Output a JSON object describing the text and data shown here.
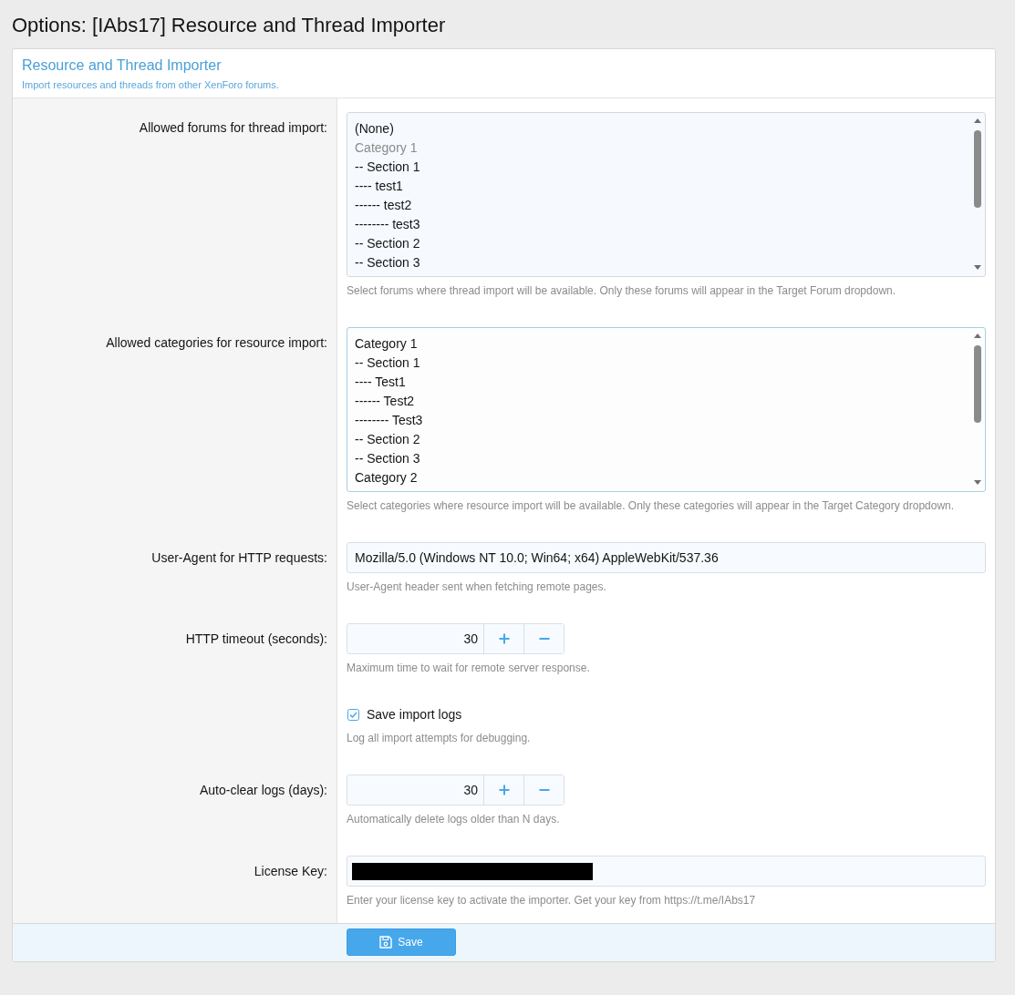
{
  "page_title": "Options: [IAbs17] Resource and Thread Importer",
  "block": {
    "title": "Resource and Thread Importer",
    "description": "Import resources and threads from other XenForo forums."
  },
  "options": [
    {
      "kind": "listbox",
      "label": "Allowed forums for thread import:",
      "focused": false,
      "items": [
        {
          "text": "(None)",
          "disabled": false
        },
        {
          "text": "Category 1",
          "disabled": true
        },
        {
          "text": "-- Section 1",
          "disabled": false
        },
        {
          "text": "---- test1",
          "disabled": false
        },
        {
          "text": "------ test2",
          "disabled": false
        },
        {
          "text": "-------- test3",
          "disabled": false
        },
        {
          "text": "-- Section 2",
          "disabled": false
        },
        {
          "text": "-- Section 3",
          "disabled": false
        }
      ],
      "hint": "Select forums where thread import will be available. Only these forums will appear in the Target Forum dropdown."
    },
    {
      "kind": "listbox",
      "label": "Allowed categories for resource import:",
      "focused": true,
      "items": [
        {
          "text": "Category 1",
          "disabled": false
        },
        {
          "text": "-- Section 1",
          "disabled": false
        },
        {
          "text": "---- Test1",
          "disabled": false
        },
        {
          "text": "------ Test2",
          "disabled": false
        },
        {
          "text": "-------- Test3",
          "disabled": false
        },
        {
          "text": "-- Section 2",
          "disabled": false
        },
        {
          "text": "-- Section 3",
          "disabled": false
        },
        {
          "text": "Category 2",
          "disabled": false
        }
      ],
      "hint": "Select categories where resource import will be available. Only these categories will appear in the Target Category dropdown."
    },
    {
      "kind": "text",
      "label": "User-Agent for HTTP requests:",
      "value": "Mozilla/5.0 (Windows NT 10.0; Win64; x64) AppleWebKit/537.36",
      "hint": "User-Agent header sent when fetching remote pages."
    },
    {
      "kind": "number",
      "label": "HTTP timeout (seconds):",
      "value": "30",
      "hint": "Maximum time to wait for remote server response."
    },
    {
      "kind": "checkbox",
      "text": "Save import logs",
      "checked": true,
      "hint": "Log all import attempts for debugging."
    },
    {
      "kind": "number",
      "label": "Auto-clear logs (days):",
      "value": "30",
      "hint": "Automatically delete logs older than N days."
    },
    {
      "kind": "text",
      "label": "License Key:",
      "redacted": true,
      "hint": "Enter your license key to activate the importer. Get your key from https://t.me/IAbs17"
    }
  ],
  "save_button": {
    "label": "Save"
  }
}
